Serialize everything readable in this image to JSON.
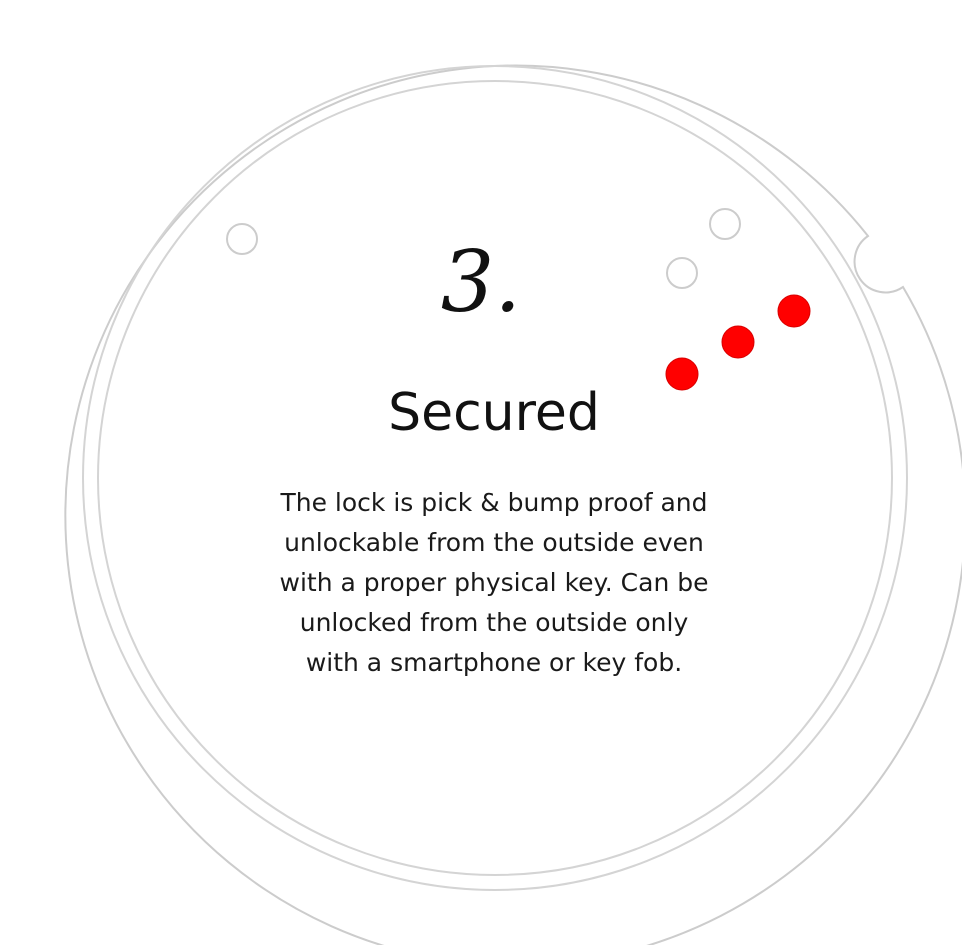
{
  "step": {
    "number": "3.",
    "title": "Secured",
    "description": "The lock is pick & bump proof and unlockable from the outside even with a proper physical key. Can be unlocked from the outside only with a smartphone or key fob."
  },
  "colors": {
    "ring": "#cccccc",
    "indicator_active": "#ff0000",
    "indicator_inactive": "#ffffff",
    "text": "#111111"
  }
}
